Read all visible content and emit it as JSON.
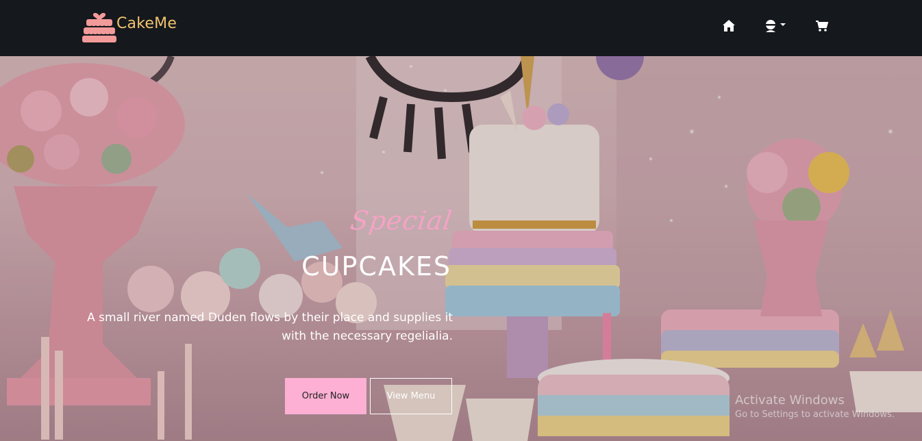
{
  "navbar": {
    "brand": "CakeMe",
    "icons": {
      "home": "home-icon",
      "user": "user-icon",
      "cart": "cart-icon"
    }
  },
  "hero": {
    "script_text": "Special",
    "title": "CUPCAKES",
    "description": "A small river named Duden flows by their place and supplies it with the necessary regelialia.",
    "order_button": "Order Now",
    "menu_button": "View Menu"
  },
  "watermark": {
    "title": "Activate Windows",
    "subtitle": "Go to Settings to activate Windows."
  },
  "colors": {
    "navbar_bg": "#15181c",
    "brand": "#f3c36f",
    "script_accent": "#f4a3c6",
    "order_button_bg": "#fdb0d4"
  }
}
